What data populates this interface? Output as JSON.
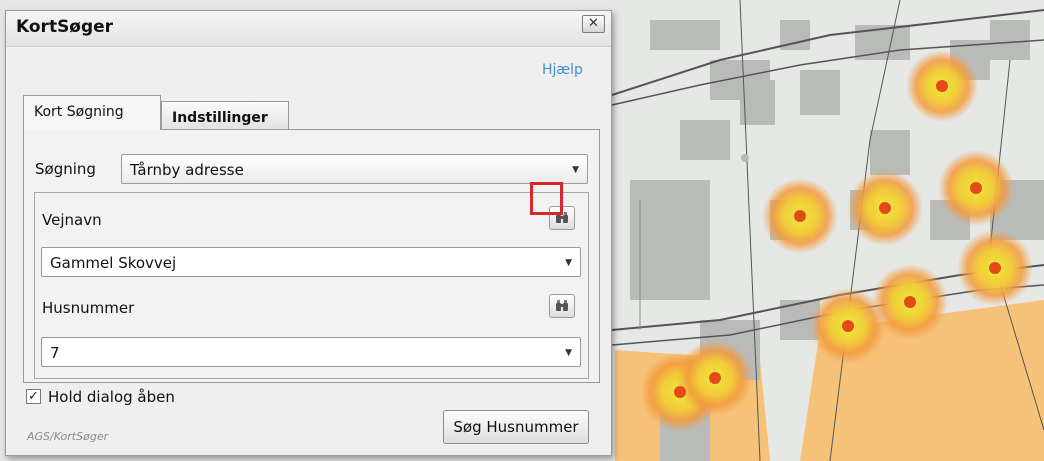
{
  "dialog": {
    "title": "KortSøger",
    "close_symbol": "✕",
    "help_label": "Hjælp",
    "tabs": [
      {
        "label": "Kort Søgning",
        "active": true
      },
      {
        "label": "Indstillinger",
        "active": false
      }
    ],
    "search_type": {
      "label": "Søgning",
      "value": "Tårnby adresse"
    },
    "street": {
      "label": "Vejnavn",
      "value": "Gammel Skovvej"
    },
    "house_number": {
      "label": "Husnummer",
      "value": "7"
    },
    "keep_open": {
      "label": "Hold dialog åben",
      "checked": true,
      "mark": "✓"
    },
    "footer": "AGS/KortSøger",
    "search_button_label": "Søg Husnummer",
    "dropdown_arrow": "▼"
  },
  "map": {
    "colors": {
      "background": "#e6e8e6",
      "building": "#b9bbb9",
      "road": "#555555",
      "highlight_area": "#f6c27a",
      "marker_glow": "#f39a3c",
      "marker_core": "#e8e23a",
      "marker_dot": "#e24a1a"
    },
    "marker_count": 10
  },
  "icons": {
    "close": "close-icon",
    "binoculars": "binoculars-icon",
    "check": "check-icon",
    "dropdown": "chevron-down-icon"
  }
}
